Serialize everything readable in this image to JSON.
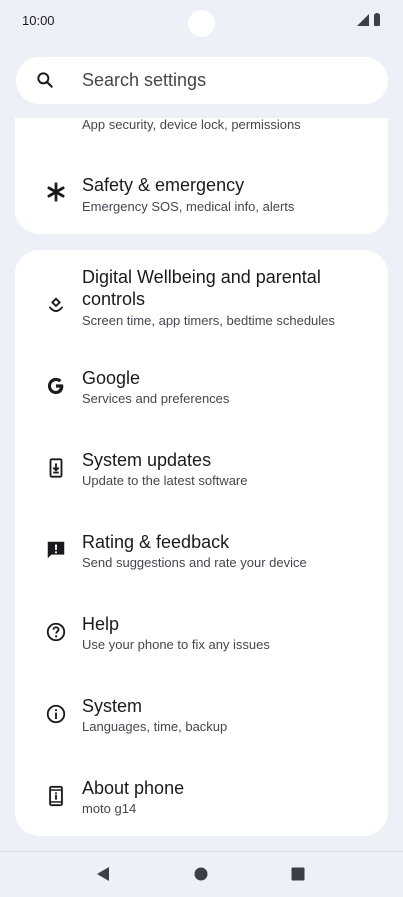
{
  "status": {
    "time": "10:00"
  },
  "search": {
    "placeholder": "Search settings"
  },
  "card1": {
    "items": [
      {
        "title": "",
        "subtitle": "App security, device lock, permissions",
        "icon": "security-icon"
      },
      {
        "title": "Safety & emergency",
        "subtitle": "Emergency SOS, medical info, alerts",
        "icon": "asterisk-icon"
      }
    ]
  },
  "card2": {
    "items": [
      {
        "title": "Digital Wellbeing and parental controls",
        "subtitle": "Screen time, app timers, bedtime schedules",
        "icon": "wellbeing-icon"
      },
      {
        "title": "Google",
        "subtitle": "Services and preferences",
        "icon": "google-icon"
      },
      {
        "title": "System updates",
        "subtitle": "Update to the latest software",
        "icon": "system-update-icon"
      },
      {
        "title": "Rating & feedback",
        "subtitle": "Send suggestions and rate your device",
        "icon": "feedback-icon"
      },
      {
        "title": "Help",
        "subtitle": "Use your phone to fix any issues",
        "icon": "help-icon"
      },
      {
        "title": "System",
        "subtitle": "Languages, time, backup",
        "icon": "info-icon"
      },
      {
        "title": "About phone",
        "subtitle": "moto g14",
        "icon": "phone-info-icon"
      }
    ]
  },
  "nav": {
    "buttons": [
      "back-icon",
      "home-icon",
      "recents-icon"
    ]
  },
  "colors": {
    "background": "#eef0f7",
    "card": "#ffffff",
    "text": "#1b1b1f",
    "subtext": "#44474f"
  }
}
